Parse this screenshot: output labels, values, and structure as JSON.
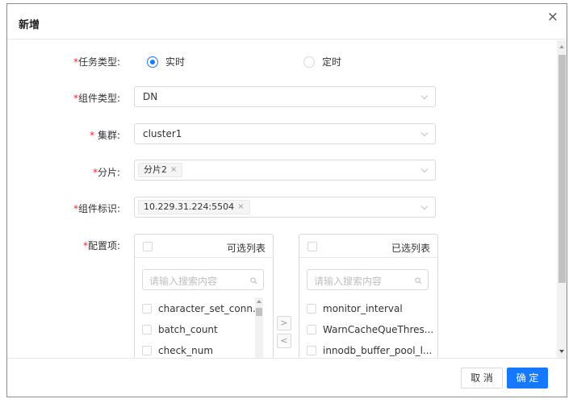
{
  "dialog": {
    "title": "新增",
    "close_icon": "×"
  },
  "form": {
    "task_type": {
      "required_mark": "*",
      "label": "任务类型:",
      "options": [
        "实时",
        "定时"
      ],
      "selected": "实时"
    },
    "component_type": {
      "required_mark": "*",
      "label": "组件类型:",
      "value": "DN"
    },
    "cluster": {
      "required_mark": "* ",
      "label": "集群:",
      "value": "cluster1"
    },
    "shard": {
      "required_mark": "*",
      "label": "分片:",
      "tags": [
        "分片2"
      ]
    },
    "component_id": {
      "required_mark": "*",
      "label": "组件标识:",
      "tags": [
        "10.229.31.224:5504"
      ]
    },
    "config_items": {
      "required_mark": "*",
      "label": "配置项:"
    }
  },
  "transfer": {
    "left": {
      "title": "可选列表",
      "search_placeholder": "请输入搜索内容",
      "items": [
        "character_set_conn...",
        "batch_count",
        "check_num"
      ]
    },
    "right": {
      "title": "已选列表",
      "search_placeholder": "请输入搜索内容",
      "items": [
        "monitor_interval",
        "WarnCacheQueThres...",
        "innodb_buffer_pool_l..."
      ]
    },
    "move_right_label": ">",
    "move_left_label": "<"
  },
  "footer": {
    "cancel_label": "取 消",
    "ok_label": "确 定"
  },
  "colors": {
    "primary": "#1677ff",
    "required": "#f5222d",
    "border": "#d9d9d9"
  }
}
